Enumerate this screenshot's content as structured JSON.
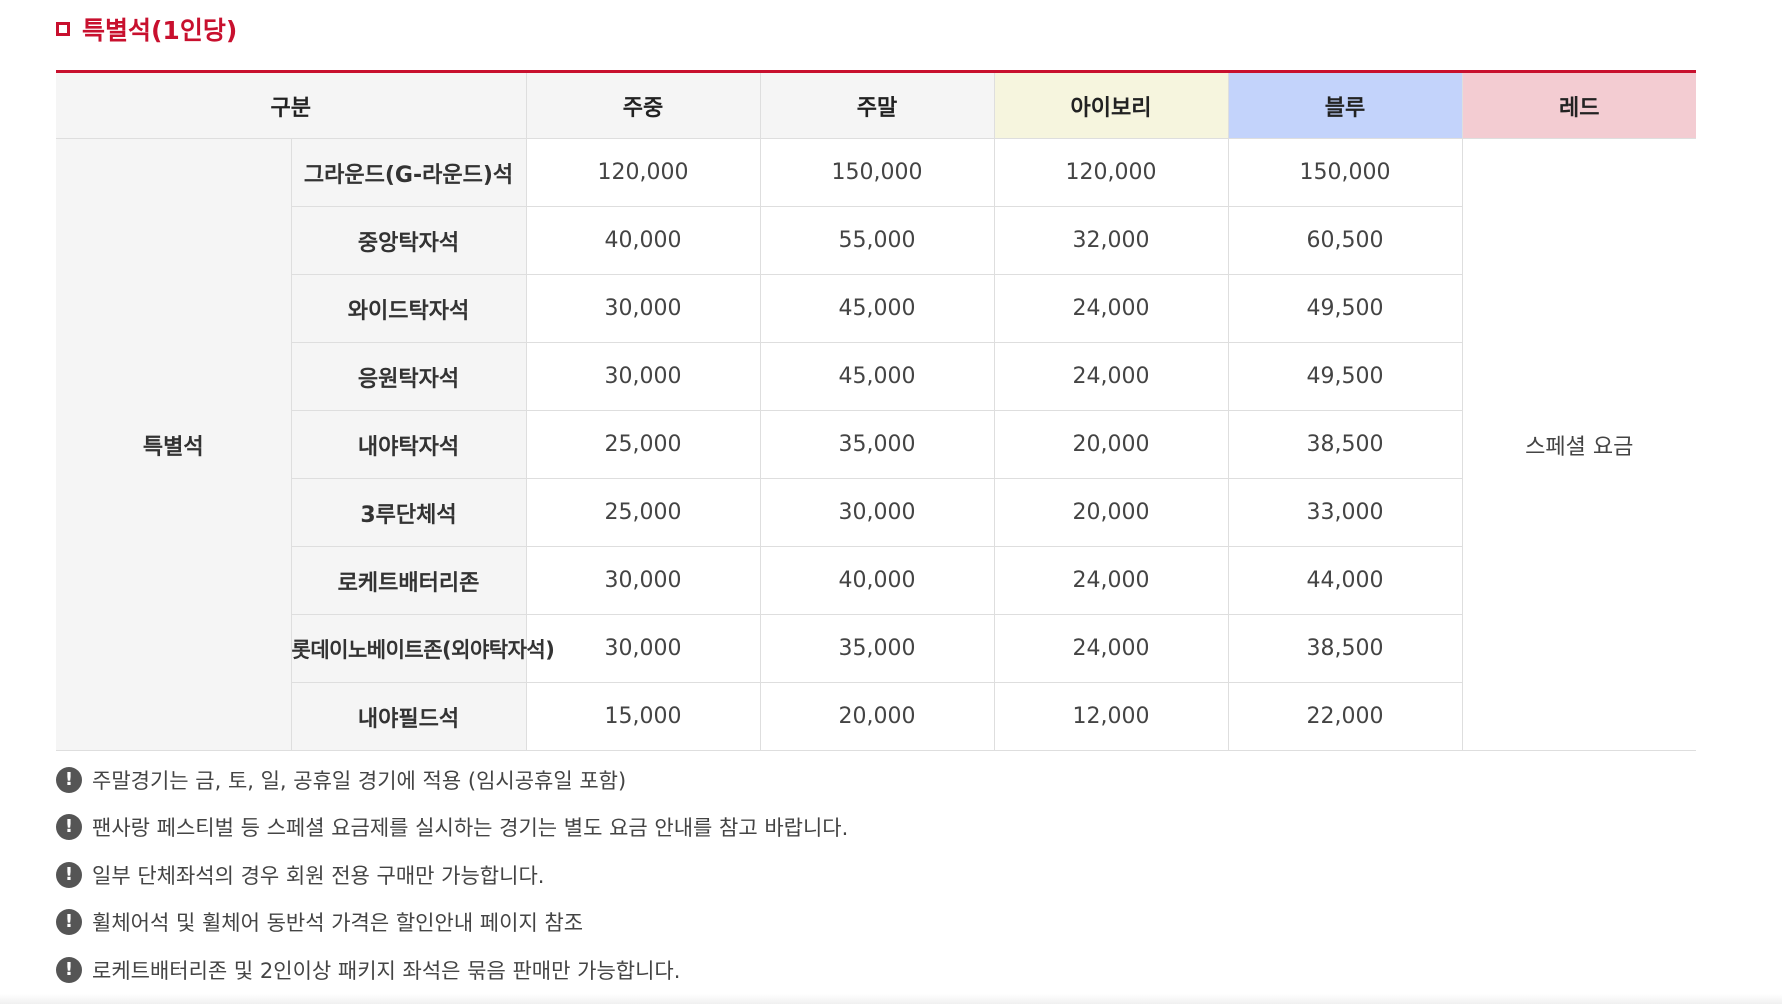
{
  "section": {
    "title": "특별석(1인당)",
    "accent_color": "#c8102e",
    "marker_icon": "square-bullet-icon"
  },
  "table": {
    "headers": {
      "category": "구분",
      "weekday": "주중",
      "weekend": "주말",
      "ivory": "아이보리",
      "blue": "블루",
      "red": "레드"
    },
    "header_colors": {
      "ivory": "#f6f5de",
      "blue": "#c3d3fb",
      "red": "#f3ccd2"
    },
    "group_label": "특별석",
    "red_value": "스페셜 요금",
    "rows": [
      {
        "name": "그라운드(G-라운드)석",
        "weekday": "120,000",
        "weekend": "150,000",
        "ivory": "120,000",
        "blue": "150,000"
      },
      {
        "name": "중앙탁자석",
        "weekday": "40,000",
        "weekend": "55,000",
        "ivory": "32,000",
        "blue": "60,500"
      },
      {
        "name": "와이드탁자석",
        "weekday": "30,000",
        "weekend": "45,000",
        "ivory": "24,000",
        "blue": "49,500"
      },
      {
        "name": "응원탁자석",
        "weekday": "30,000",
        "weekend": "45,000",
        "ivory": "24,000",
        "blue": "49,500"
      },
      {
        "name": "내야탁자석",
        "weekday": "25,000",
        "weekend": "35,000",
        "ivory": "20,000",
        "blue": "38,500"
      },
      {
        "name": "3루단체석",
        "weekday": "25,000",
        "weekend": "30,000",
        "ivory": "20,000",
        "blue": "33,000"
      },
      {
        "name": "로케트배터리존",
        "weekday": "30,000",
        "weekend": "40,000",
        "ivory": "24,000",
        "blue": "44,000"
      },
      {
        "name": "롯데이노베이트존(외야탁자석)",
        "weekday": "30,000",
        "weekend": "35,000",
        "ivory": "24,000",
        "blue": "38,500"
      },
      {
        "name": "내야필드석",
        "weekday": "15,000",
        "weekend": "20,000",
        "ivory": "12,000",
        "blue": "22,000"
      }
    ]
  },
  "notes": {
    "icon": "exclamation-circle-icon",
    "icon_glyph": "!",
    "items": [
      "주말경기는 금, 토, 일, 공휴일 경기에 적용 (임시공휴일 포함)",
      "팬사랑 페스티벌 등 스페셜 요금제를 실시하는 경기는 별도 요금 안내를 참고 바랍니다.",
      "일부 단체좌석의 경우 회원 전용 구매만 가능합니다.",
      "휠체어석 및 휠체어 동반석 가격은 할인안내 페이지 참조",
      "로케트배터리존 및 2인이상 패키지 좌석은 묶음 판매만 가능합니다."
    ]
  }
}
